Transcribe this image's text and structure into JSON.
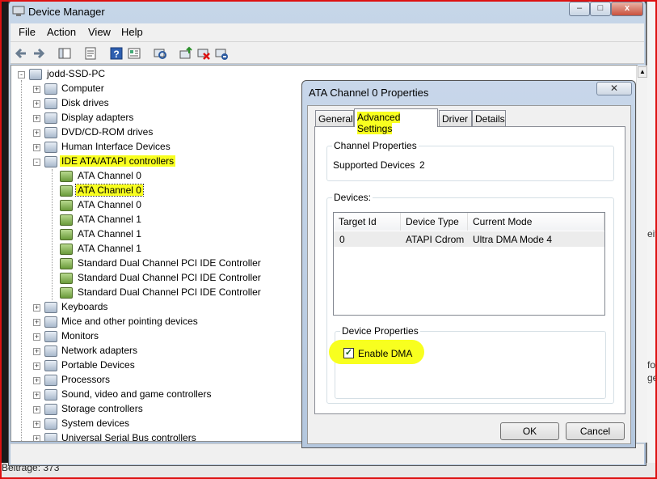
{
  "background": {
    "right_fragments": [
      "eit",
      "fo",
      "ge"
    ],
    "bottom_text": "Beiträge: 373"
  },
  "window": {
    "title": "Device Manager",
    "min_glyph": "–",
    "max_glyph": "□",
    "close_glyph": "x",
    "menu": [
      "File",
      "Action",
      "View",
      "Help"
    ],
    "toolbar_icons": [
      "back-arrow-icon",
      "forward-arrow-icon",
      "show-hide-console-tree-icon",
      "properties-icon",
      "help-icon",
      "properties-sheet-icon",
      "scan-hardware-icon",
      "update-driver-icon",
      "uninstall-icon",
      "disable-icon"
    ]
  },
  "tree": {
    "root": "jodd-SSD-PC",
    "items": [
      {
        "label": "Computer",
        "level": 1,
        "expander": "+",
        "icon": "computer-icon"
      },
      {
        "label": "Disk drives",
        "level": 1,
        "expander": "+",
        "icon": "disk-drive-icon"
      },
      {
        "label": "Display adapters",
        "level": 1,
        "expander": "+",
        "icon": "display-adapter-icon"
      },
      {
        "label": "DVD/CD-ROM drives",
        "level": 1,
        "expander": "+",
        "icon": "dvd-drive-icon"
      },
      {
        "label": "Human Interface Devices",
        "level": 1,
        "expander": "+",
        "icon": "hid-icon"
      },
      {
        "label": "IDE ATA/ATAPI controllers",
        "level": 1,
        "expander": "-",
        "icon": "ide-controller-icon",
        "highlight": true
      },
      {
        "label": "ATA Channel 0",
        "level": 2,
        "icon": "ata-channel-icon"
      },
      {
        "label": "ATA Channel 0",
        "level": 2,
        "icon": "ata-channel-icon",
        "highlight": true,
        "selected": true
      },
      {
        "label": "ATA Channel 0",
        "level": 2,
        "icon": "ata-channel-icon"
      },
      {
        "label": "ATA Channel 1",
        "level": 2,
        "icon": "ata-channel-icon"
      },
      {
        "label": "ATA Channel 1",
        "level": 2,
        "icon": "ata-channel-icon"
      },
      {
        "label": "ATA Channel 1",
        "level": 2,
        "icon": "ata-channel-icon"
      },
      {
        "label": "Standard Dual Channel PCI IDE Controller",
        "level": 2,
        "icon": "ide-controller-icon"
      },
      {
        "label": "Standard Dual Channel PCI IDE Controller",
        "level": 2,
        "icon": "ide-controller-icon"
      },
      {
        "label": "Standard Dual Channel PCI IDE Controller",
        "level": 2,
        "icon": "ide-controller-icon"
      },
      {
        "label": "Keyboards",
        "level": 1,
        "expander": "+",
        "icon": "keyboard-icon"
      },
      {
        "label": "Mice and other pointing devices",
        "level": 1,
        "expander": "+",
        "icon": "mouse-icon"
      },
      {
        "label": "Monitors",
        "level": 1,
        "expander": "+",
        "icon": "monitor-icon"
      },
      {
        "label": "Network adapters",
        "level": 1,
        "expander": "+",
        "icon": "network-adapter-icon"
      },
      {
        "label": "Portable Devices",
        "level": 1,
        "expander": "+",
        "icon": "portable-device-icon"
      },
      {
        "label": "Processors",
        "level": 1,
        "expander": "+",
        "icon": "processor-icon"
      },
      {
        "label": "Sound, video and game controllers",
        "level": 1,
        "expander": "+",
        "icon": "sound-icon"
      },
      {
        "label": "Storage controllers",
        "level": 1,
        "expander": "+",
        "icon": "storage-controller-icon"
      },
      {
        "label": "System devices",
        "level": 1,
        "expander": "+",
        "icon": "system-device-icon"
      },
      {
        "label": "Universal Serial Bus controllers",
        "level": 1,
        "expander": "+",
        "icon": "usb-icon"
      }
    ]
  },
  "dialog": {
    "title": "ATA Channel 0 Properties",
    "close_glyph": "✕",
    "tabs": [
      "General",
      "Advanced Settings",
      "Driver",
      "Details"
    ],
    "active_tab": "Advanced Settings",
    "channel_properties": {
      "legend": "Channel Properties",
      "supported_devices_label": "Supported Devices",
      "supported_devices_value": "2"
    },
    "devices": {
      "legend": "Devices:",
      "columns": [
        "Target Id",
        "Device Type",
        "Current Mode"
      ],
      "rows": [
        [
          "0",
          "ATAPI Cdrom",
          "Ultra DMA Mode 4"
        ]
      ]
    },
    "device_properties": {
      "legend": "Device Properties",
      "enable_dma_label": "Enable DMA",
      "enable_dma_checked": true,
      "check_glyph": "✓"
    },
    "ok_label": "OK",
    "cancel_label": "Cancel"
  },
  "colors": {
    "highlight": "#f8ff1f",
    "window_frame": "#b4c7de",
    "red_border": "#dd1111"
  }
}
